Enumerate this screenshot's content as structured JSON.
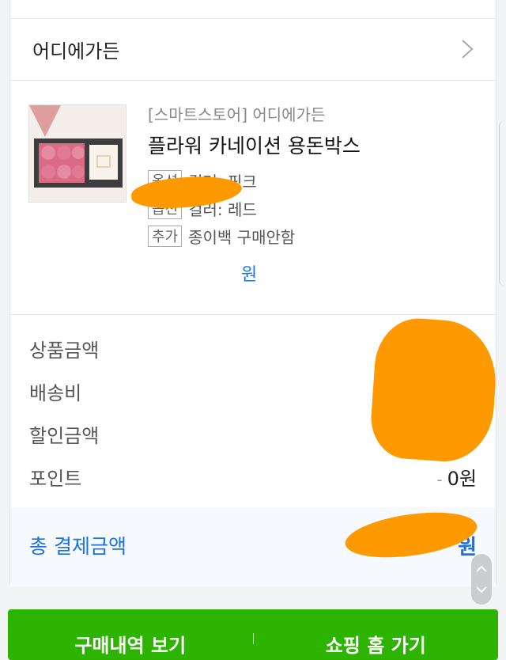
{
  "store": {
    "name": "어디에가든"
  },
  "product": {
    "store_tag": "[스마트스토어] 어디에가든",
    "name": "플라워 카네이션 용돈박스",
    "options": [
      {
        "badge": "옵션",
        "text": "컬러: 핑크"
      },
      {
        "badge": "옵션",
        "text": "컬러: 레드"
      },
      {
        "badge": "추가",
        "text": "종이백 구매안함"
      }
    ],
    "price_suffix": "원"
  },
  "summary": {
    "product_amount_label": "상품금액",
    "shipping_label": "배송비",
    "discount_label": "할인금액",
    "point_label": "포인트",
    "point_value": "0원",
    "minus": "-"
  },
  "total": {
    "label": "총 결제금액",
    "value_suffix": "원"
  },
  "bottom": {
    "left_label": "구매내역 보기",
    "right_label": "쇼핑 홈 가기"
  },
  "colors": {
    "accent": "#1a73e8",
    "brand_green": "#2db400",
    "scribble": "#ff9900"
  }
}
